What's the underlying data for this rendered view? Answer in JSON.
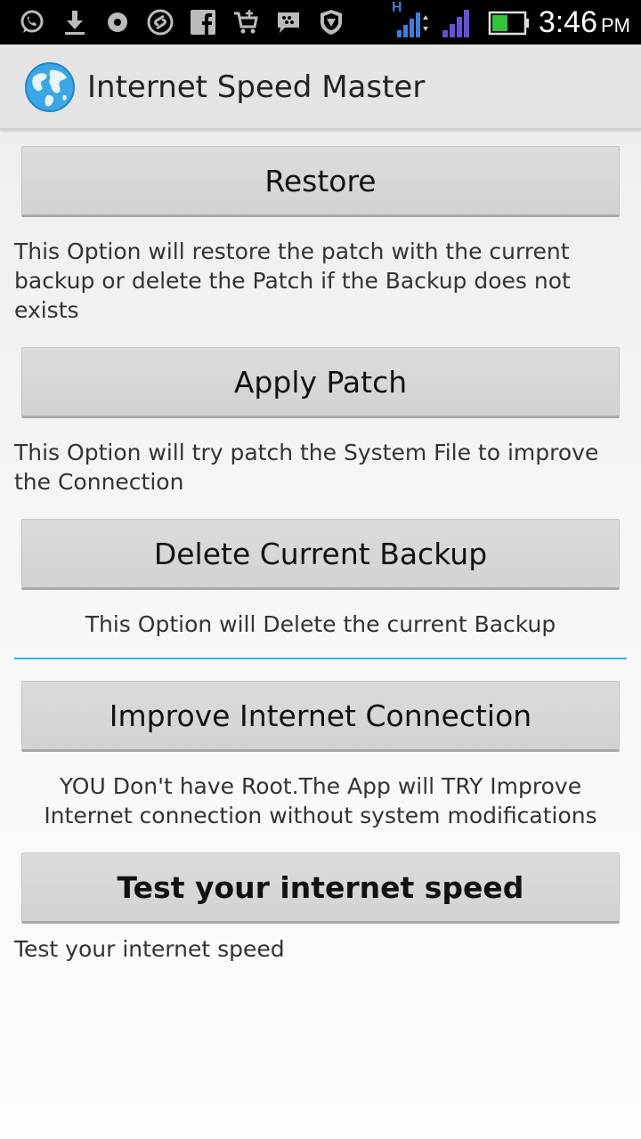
{
  "status_bar": {
    "time": "3:46",
    "ampm": "PM",
    "network_label": "H",
    "icons": [
      "whatsapp-icon",
      "download-icon",
      "media-icon",
      "shazam-icon",
      "facebook-icon",
      "shop-icon",
      "bbm-icon",
      "shield-icon",
      "network-h-icon",
      "signal-icon",
      "battery-icon"
    ],
    "accent_color": "#33b5e5"
  },
  "action_bar": {
    "title": "Internet Speed Master",
    "icon": "globe-icon"
  },
  "sections": [
    {
      "button": "Restore",
      "description": "This Option will restore the patch with the current backup or delete the Patch if the Backup does not exists"
    },
    {
      "button": "Apply Patch",
      "description": "This Option will try patch the System File to improve the Connection"
    },
    {
      "button": "Delete Current Backup",
      "description": "This Option will Delete the current Backup"
    },
    {
      "button": "Improve Internet Connection",
      "description": "YOU Don't have Root.The App will TRY Improve Internet connection without system modifications"
    },
    {
      "button": "Test your internet speed",
      "description": "Test your internet speed"
    }
  ]
}
